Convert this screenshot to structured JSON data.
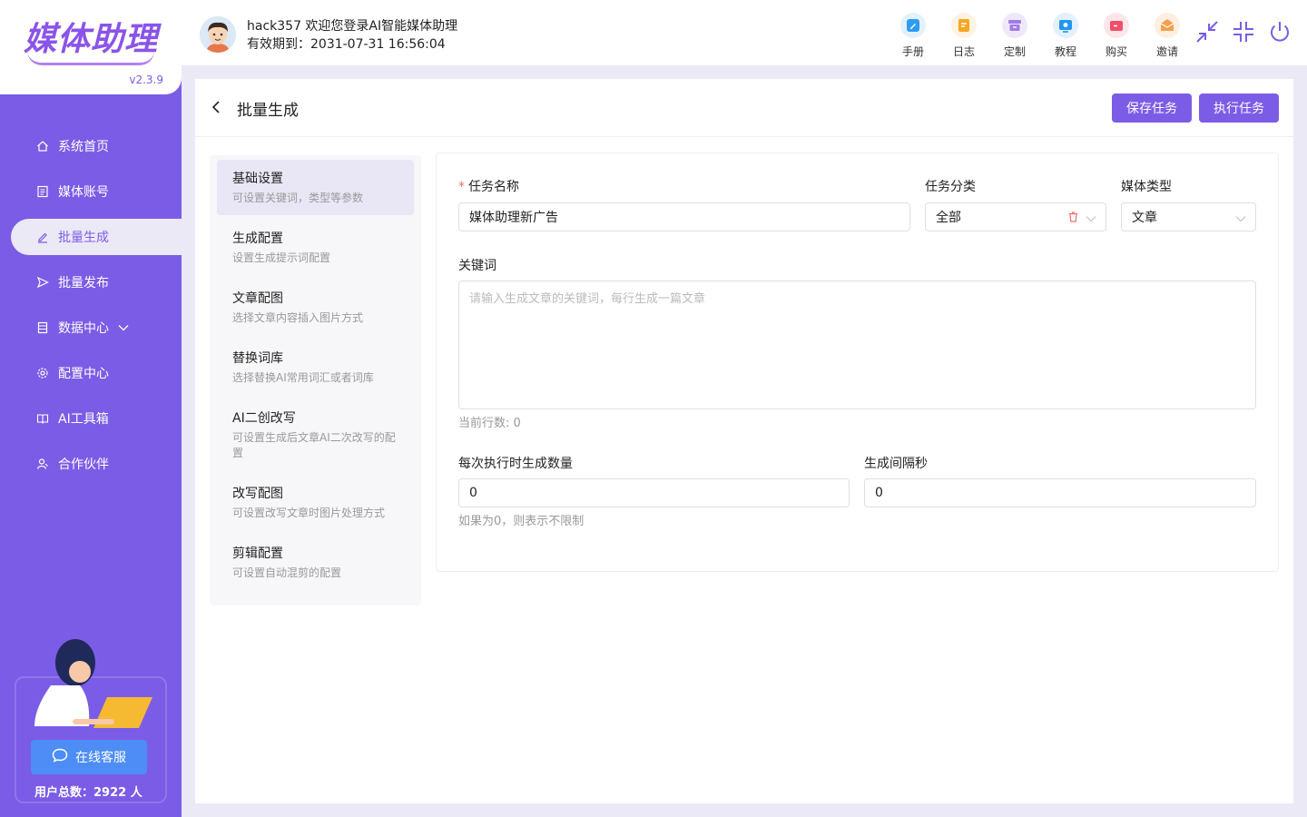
{
  "app": {
    "logo_text": "媒体助理",
    "version": "v2.3.9",
    "welcome": "hack357 欢迎您登录AI智能媒体助理",
    "expiry": "有效期到：2031-07-31 16:56:04"
  },
  "sidebar": {
    "items": [
      {
        "label": "系统首页",
        "icon": "home-icon"
      },
      {
        "label": "媒体账号",
        "icon": "account-icon"
      },
      {
        "label": "批量生成",
        "icon": "edit-icon",
        "active": true
      },
      {
        "label": "批量发布",
        "icon": "send-icon"
      },
      {
        "label": "数据中心",
        "icon": "data-icon",
        "has_submenu": true
      },
      {
        "label": "配置中心",
        "icon": "gear-icon"
      },
      {
        "label": "AI工具箱",
        "icon": "book-icon"
      },
      {
        "label": "合作伙伴",
        "icon": "partner-icon"
      }
    ],
    "support_label": "在线客服",
    "user_total": "用户总数：2922 人"
  },
  "header": {
    "tools": [
      {
        "label": "手册",
        "color": "#2f9cf4",
        "bg": "#e4f1fd"
      },
      {
        "label": "日志",
        "color": "#f5a623",
        "bg": "#fdf3e2"
      },
      {
        "label": "定制",
        "color": "#a07be8",
        "bg": "#efe8fb"
      },
      {
        "label": "教程",
        "color": "#2196f3",
        "bg": "#e3f1fd"
      },
      {
        "label": "购买",
        "color": "#f24e6a",
        "bg": "#fde6ea"
      },
      {
        "label": "邀请",
        "color": "#f5a04a",
        "bg": "#fdefe1"
      }
    ]
  },
  "page": {
    "title": "批量生成",
    "save_label": "保存任务",
    "exec_label": "执行任务"
  },
  "steps": [
    {
      "title": "基础设置",
      "desc": "可设置关键词，类型等参数",
      "active": true
    },
    {
      "title": "生成配置",
      "desc": "设置生成提示词配置"
    },
    {
      "title": "文章配图",
      "desc": "选择文章内容插入图片方式"
    },
    {
      "title": "替换词库",
      "desc": "选择替换AI常用词汇或者词库"
    },
    {
      "title": "AI二创改写",
      "desc": "可设置生成后文章AI二次改写的配置"
    },
    {
      "title": "改写配图",
      "desc": "可设置改写文章时图片处理方式"
    },
    {
      "title": "剪辑配置",
      "desc": "可设置自动混剪的配置"
    }
  ],
  "form": {
    "task_name_label": "任务名称",
    "task_name_value": "媒体助理新广告",
    "category_label": "任务分类",
    "category_value": "全部",
    "media_type_label": "媒体类型",
    "media_type_value": "文章",
    "keywords_label": "关键词",
    "keywords_placeholder": "请输入生成文章的关键词，每行生成一篇文章",
    "line_count": "当前行数: 0",
    "per_run_label": "每次执行时生成数量",
    "per_run_value": "0",
    "per_run_hint": "如果为0，则表示不限制",
    "interval_label": "生成间隔秒",
    "interval_value": "0"
  }
}
